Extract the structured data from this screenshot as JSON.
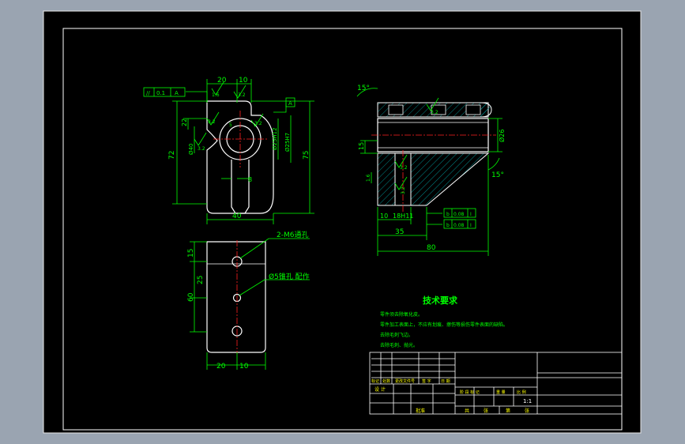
{
  "colors": {
    "background": "#9aa4b1",
    "paper": "#000000",
    "outline": "#ffffff",
    "dimension": "#00ff00",
    "centerline": "#ff2020",
    "hatch": "#00a6a6",
    "note_text": "#00ff00",
    "table_text": "#ffff00"
  },
  "front_view": {
    "dims": {
      "top_20": "20",
      "top_10": "10",
      "left_22": "22",
      "left_72": "72",
      "right_75": "75",
      "bottom_40": "40",
      "stem_8": "8",
      "bore_small": "Ø25H12",
      "bore_large": "Ø25H7",
      "outer_dia": "Ø40",
      "angle_5": "5"
    },
    "rough": [
      "1.6",
      "3.2",
      "3.2",
      "3.2",
      "3.2"
    ],
    "tolerance_frame": [
      "//",
      "0.1",
      "A"
    ],
    "datum": "A"
  },
  "top_view": {
    "dims": {
      "left_15": "15",
      "left_25": "25",
      "left_60": "60",
      "bottom_20": "20",
      "bottom_10": "10"
    },
    "note_holes": "2-M6通孔",
    "note_pin": "Ø5锥孔 配作"
  },
  "side_view": {
    "dims": {
      "angle_top": "15°",
      "angle_bottom": "15°",
      "dia_26": "Ø26",
      "height_15": "15",
      "bottom_35": "35",
      "bottom_80": "80",
      "slot_10": "10",
      "fit": "18H11"
    },
    "rough": [
      "3.2",
      "3.2",
      "1.6",
      "3.2"
    ],
    "tol_frames": [
      [
        "b",
        "0.08",
        "I"
      ],
      [
        "b",
        "0.08",
        "I"
      ]
    ]
  },
  "notes": {
    "title": "技术要求",
    "lines": [
      "零件须去除氧化皮。",
      "零件加工表面上，不应有划痕、擦伤等损伤零件表面的缺陷。",
      "去除毛刺飞边。",
      "去除毛刺、抛光。"
    ]
  },
  "title_block": {
    "scale": "1:1",
    "header_labels": [
      "标记",
      "处数",
      "更改文件号",
      "签 字",
      "日 期"
    ],
    "design_label": "设 计",
    "approve_label": "批准",
    "stage_labels": [
      "阶 段 标 记",
      "重 量",
      "比 例"
    ],
    "sheet_labels": [
      "共",
      "张",
      "第",
      "张"
    ]
  }
}
